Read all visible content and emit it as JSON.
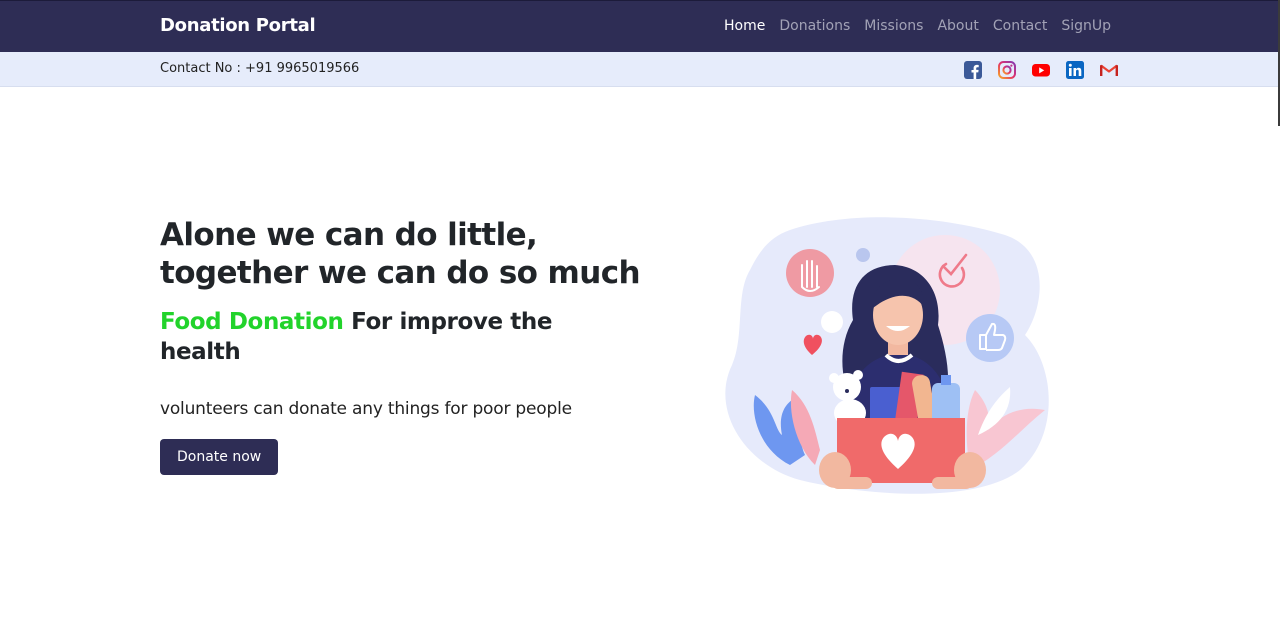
{
  "navbar": {
    "brand": "Donation Portal",
    "links": [
      {
        "label": "Home",
        "active": true
      },
      {
        "label": "Donations",
        "active": false
      },
      {
        "label": "Missions",
        "active": false
      },
      {
        "label": "About",
        "active": false
      },
      {
        "label": "Contact",
        "active": false
      },
      {
        "label": "SignUp",
        "active": false
      }
    ]
  },
  "contact_bar": {
    "contact_text": "Contact No : +91 9965019566",
    "socials": [
      "facebook-icon",
      "instagram-icon",
      "youtube-icon",
      "linkedin-icon",
      "gmail-icon"
    ]
  },
  "hero": {
    "headline_line1": "Alone we can do little,",
    "headline_line2": "together we can do so much",
    "sub_highlight": "Food Donation",
    "sub_rest": " For improve the health",
    "tagline": "volunteers can donate any things for poor people",
    "button_label": "Donate now"
  },
  "colors": {
    "navbar": "#2e2d55",
    "contact_bar": "#e6ecfb",
    "highlight": "#22d32b",
    "button": "#2e2d55"
  }
}
